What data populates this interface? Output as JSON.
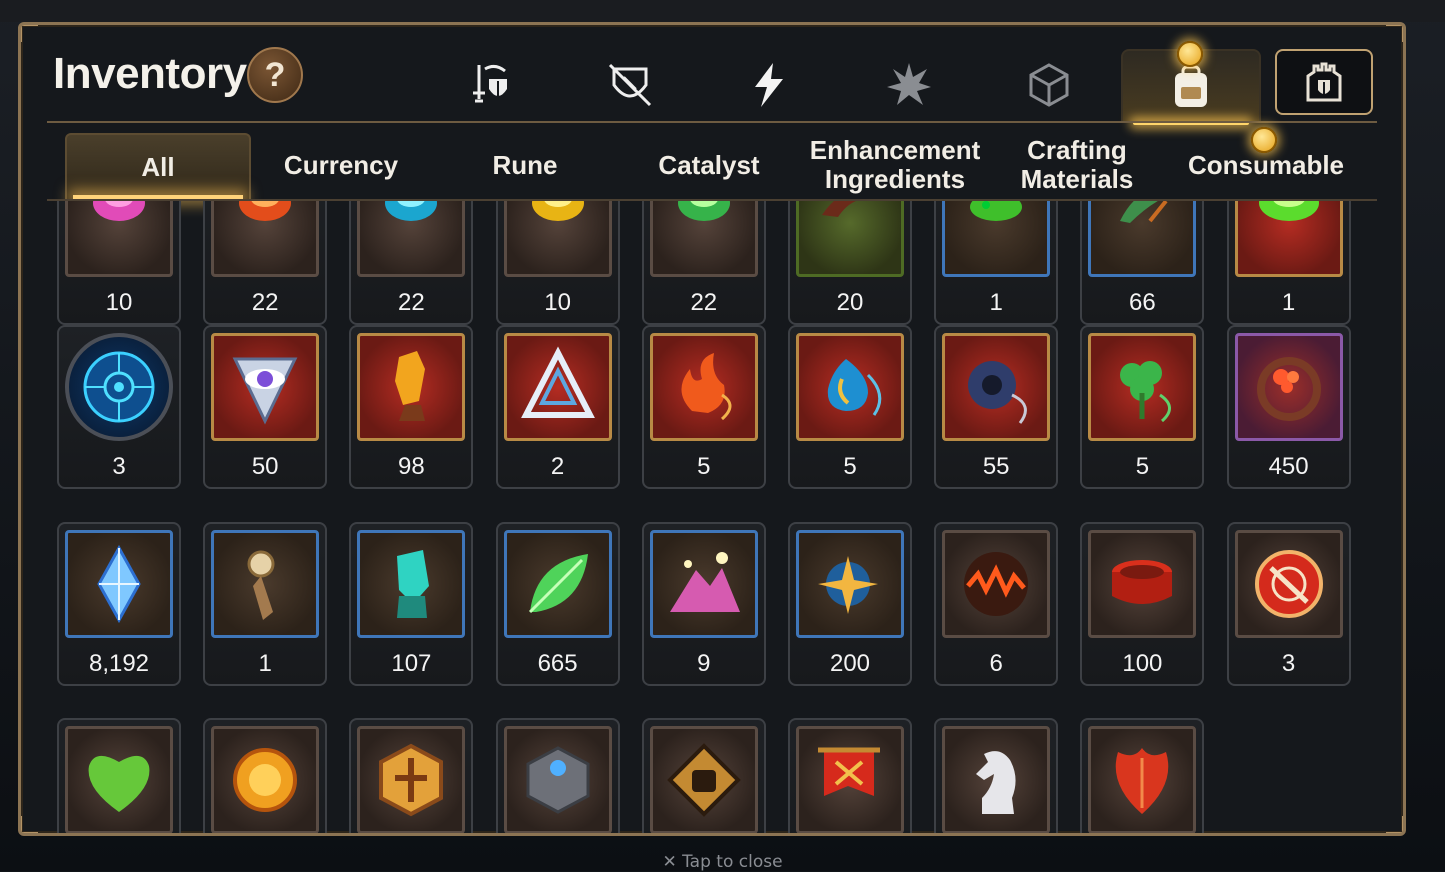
{
  "window_title": "Inventory",
  "close_hint": "✕ Tap to close",
  "help_label": "?",
  "category_tabs": [
    {
      "name": "artifact-tab",
      "icon": "sword-shield-icon",
      "active": false
    },
    {
      "name": "accessory-tab",
      "icon": "broken-shield-icon",
      "active": false
    },
    {
      "name": "skill-tab",
      "icon": "lightning-icon",
      "active": false
    },
    {
      "name": "star-tab",
      "icon": "burst-icon",
      "active": false
    },
    {
      "name": "cube-tab",
      "icon": "cube-icon",
      "active": false
    },
    {
      "name": "items-tab",
      "icon": "backpack-icon",
      "active": true
    }
  ],
  "squad_button_icon": "castle-shield-icon",
  "sub_tabs": [
    {
      "label": "All",
      "active": true
    },
    {
      "label": "Currency",
      "active": false
    },
    {
      "label": "Rune",
      "active": false
    },
    {
      "label": "Catalyst",
      "active": false
    },
    {
      "label": "Enhancement\nIngredients",
      "active": false
    },
    {
      "label": "Crafting\nMaterials",
      "active": false
    },
    {
      "label": "Consumable",
      "active": false
    }
  ],
  "rows": [
    [
      {
        "qty": "10",
        "icon": "pink-gem-icon",
        "frame": "gray"
      },
      {
        "qty": "22",
        "icon": "orange-gem-icon",
        "frame": "gray"
      },
      {
        "qty": "22",
        "icon": "cyan-gem-icon",
        "frame": "gray"
      },
      {
        "qty": "10",
        "icon": "yellow-gem-icon",
        "frame": "gray"
      },
      {
        "qty": "22",
        "icon": "green-gem-icon",
        "frame": "gray"
      },
      {
        "qty": "20",
        "icon": "claw-icon",
        "frame": "green"
      },
      {
        "qty": "1",
        "icon": "slime-icon",
        "frame": "blue"
      },
      {
        "qty": "66",
        "icon": "herb-icon",
        "frame": "blue"
      },
      {
        "qty": "1",
        "icon": "green-orb-icon",
        "frame": "red"
      }
    ],
    [
      {
        "qty": "3",
        "icon": "rune-circle-icon",
        "frame": "circle"
      },
      {
        "qty": "50",
        "icon": "eye-crest-icon",
        "frame": "red"
      },
      {
        "qty": "98",
        "icon": "amber-crystal-icon",
        "frame": "red"
      },
      {
        "qty": "2",
        "icon": "triangle-knot-icon",
        "frame": "red"
      },
      {
        "qty": "5",
        "icon": "flame-charm-icon",
        "frame": "red"
      },
      {
        "qty": "5",
        "icon": "water-charm-icon",
        "frame": "red"
      },
      {
        "qty": "55",
        "icon": "disc-charm-icon",
        "frame": "red"
      },
      {
        "qty": "5",
        "icon": "clover-charm-icon",
        "frame": "red"
      },
      {
        "qty": "450",
        "icon": "flower-ring-icon",
        "frame": "purple"
      }
    ],
    [
      {
        "qty": "8,192",
        "icon": "blue-crystal-icon",
        "frame": "blue"
      },
      {
        "qty": "1",
        "icon": "compass-dagger-icon",
        "frame": "blue"
      },
      {
        "qty": "107",
        "icon": "teal-crystal-icon",
        "frame": "blue"
      },
      {
        "qty": "665",
        "icon": "leaf-icon",
        "frame": "blue"
      },
      {
        "qty": "9",
        "icon": "pink-mountain-icon",
        "frame": "blue"
      },
      {
        "qty": "200",
        "icon": "star-charm-icon",
        "frame": "blue"
      },
      {
        "qty": "6",
        "icon": "lava-orb-icon",
        "frame": "gray"
      },
      {
        "qty": "100",
        "icon": "red-band-icon",
        "frame": "gray"
      },
      {
        "qty": "3",
        "icon": "red-seal-icon",
        "frame": "gray"
      }
    ],
    [
      {
        "qty": "",
        "icon": "green-heart-icon",
        "frame": "gray"
      },
      {
        "qty": "",
        "icon": "sun-coin-icon",
        "frame": "gray"
      },
      {
        "qty": "",
        "icon": "hex-badge-icon",
        "frame": "gray"
      },
      {
        "qty": "",
        "icon": "stone-cube-icon",
        "frame": "gray"
      },
      {
        "qty": "",
        "icon": "fist-emblem-icon",
        "frame": "gray"
      },
      {
        "qty": "",
        "icon": "war-banner-icon",
        "frame": "gray"
      },
      {
        "qty": "",
        "icon": "knight-piece-icon",
        "frame": "gray"
      },
      {
        "qty": "",
        "icon": "red-leaf-icon",
        "frame": "gray"
      }
    ]
  ],
  "colors": {
    "panel_border": "#8c7453",
    "highlight": "#ffd66b",
    "rare_frame": "#b88a45",
    "uncommon_frame": "#3f76b9",
    "epic_frame": "#8b59a8"
  }
}
